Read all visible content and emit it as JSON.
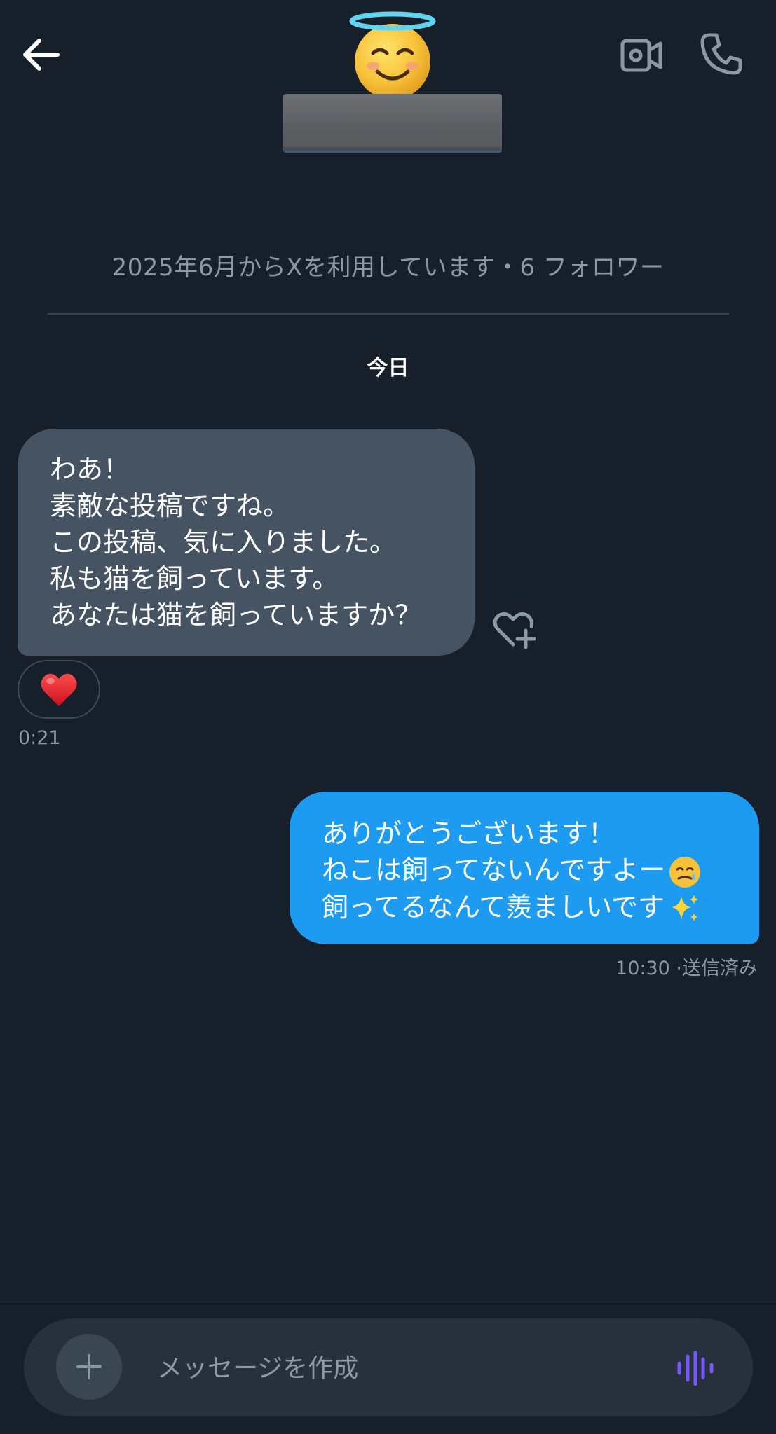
{
  "header": {
    "back_icon": "arrow-left-icon",
    "avatar_icon": "smiling-face-with-halo-emoji",
    "video_icon": "video-camera-icon",
    "call_icon": "phone-icon"
  },
  "profile": {
    "meta": "2025年6月からXを利用しています・6 フォロワー"
  },
  "conversation": {
    "date_separator": "今日",
    "received": {
      "lines": [
        "わあ！",
        "素敵な投稿ですね。",
        "この投稿、気に入りました。",
        "私も猫を飼っています。",
        "あなたは猫を飼っていますか？"
      ],
      "reaction": "❤️",
      "timestamp": "0:21",
      "react_icon": "heart-plus-icon"
    },
    "sent": {
      "lines": [
        "ありがとうございます！",
        "ねこは飼ってないんですよー",
        "飼ってるなんて羨ましいです"
      ],
      "emojis": [
        "face-holding-back-tears-emoji",
        "sparkles-emoji"
      ],
      "timestamp": "10:30 ·送信済み"
    }
  },
  "composer": {
    "placeholder": "メッセージを作成",
    "add_icon": "plus-icon",
    "voice_icon": "voice-waveform-icon"
  },
  "colors": {
    "background": "#17202a",
    "received_bubble": "#455363",
    "sent_bubble": "#1d9bf0",
    "muted_text": "#8b98a5",
    "voice_accent": "#7856ff"
  }
}
